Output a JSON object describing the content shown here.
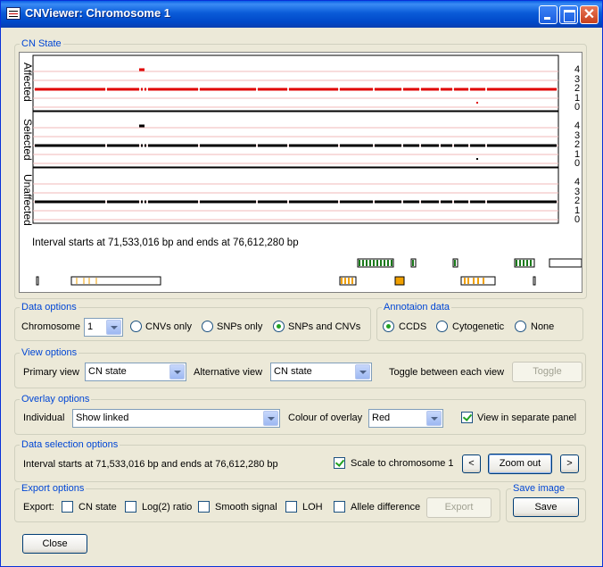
{
  "window": {
    "title": "CNViewer: Chromosome 1"
  },
  "cn_state_panel": {
    "label": "CN State",
    "tracks": [
      {
        "name": "Affected",
        "color": "#e00000"
      },
      {
        "name": "Selected",
        "color": "#000000"
      },
      {
        "name": "Unaffected",
        "color": "#000000"
      }
    ],
    "scale_labels": [
      "4",
      "3",
      "2",
      "1",
      "0"
    ],
    "interval_text": "Interval starts at 71,533,016 bp and ends at 76,612,280 bp"
  },
  "data_options": {
    "label": "Data options",
    "chromosome_label": "Chromosome",
    "chromosome_value": "1",
    "radios": [
      {
        "label": "CNVs only",
        "selected": false
      },
      {
        "label": "SNPs only",
        "selected": false
      },
      {
        "label": "SNPs and CNVs",
        "selected": true
      }
    ]
  },
  "annotation_data": {
    "label": "Annotaion data",
    "radios": [
      {
        "label": "CCDS",
        "selected": true
      },
      {
        "label": "Cytogenetic",
        "selected": false
      },
      {
        "label": "None",
        "selected": false
      }
    ]
  },
  "view_options": {
    "label": "View options",
    "primary_label": "Primary view",
    "primary_value": "CN state",
    "alternative_label": "Alternative view",
    "alternative_value": "CN state",
    "toggle_text": "Toggle between each view",
    "toggle_button": "Toggle"
  },
  "overlay_options": {
    "label": "Overlay options",
    "individual_label": "Individual",
    "individual_value": "Show linked",
    "colour_label": "Colour of overlay",
    "colour_value": "Red",
    "separate_panel_label": "View in separate panel",
    "separate_panel_checked": true
  },
  "data_selection": {
    "label": "Data selection options",
    "interval_text": "Interval starts at 71,533,016 bp and ends at 76,612,280 bp",
    "scale_label": "Scale to chromosome 1",
    "scale_checked": true,
    "prev_symbol": "<",
    "zoom_out": "Zoom out",
    "next_symbol": ">"
  },
  "export_options": {
    "label": "Export options",
    "export_label": "Export:",
    "checks": [
      {
        "label": "CN state",
        "checked": false
      },
      {
        "label": "Log(2) ratio",
        "checked": false
      },
      {
        "label": "Smooth signal",
        "checked": false
      },
      {
        "label": "LOH",
        "checked": false
      },
      {
        "label": "Allele difference",
        "checked": false
      }
    ],
    "export_button": "Export"
  },
  "save_image": {
    "label": "Save image",
    "save_button": "Save"
  },
  "close_button": "Close",
  "colors": {
    "accent_label": "#0046d5",
    "affected": "#e00000",
    "annotation_green": "#1a7a1a",
    "annotation_orange": "#f0a000"
  }
}
